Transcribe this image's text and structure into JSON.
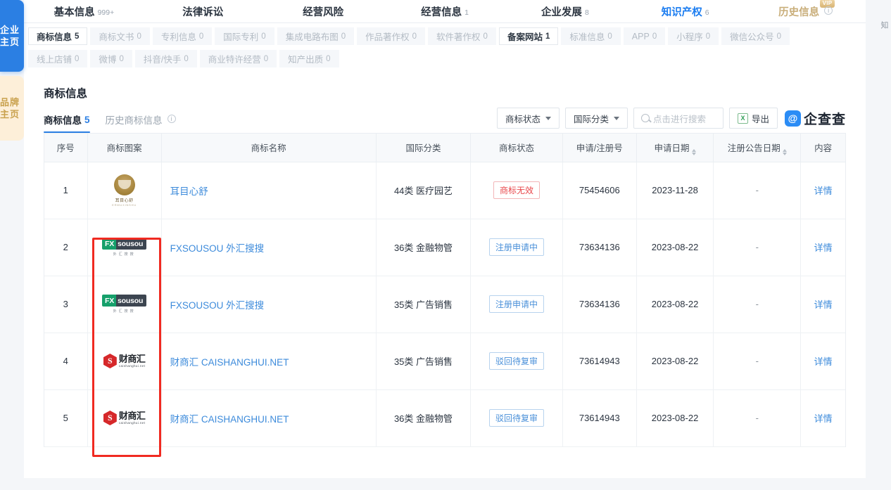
{
  "rail": {
    "tabs": [
      {
        "label": "企业主页",
        "active": true
      },
      {
        "label": "品牌主页",
        "active": false
      }
    ]
  },
  "topnav": {
    "items": [
      {
        "label": "基本信息",
        "count": "999+",
        "active": false
      },
      {
        "label": "法律诉讼",
        "count": "",
        "active": false
      },
      {
        "label": "经营风险",
        "count": "",
        "active": false
      },
      {
        "label": "经营信息",
        "count": "1",
        "active": false
      },
      {
        "label": "企业发展",
        "count": "8",
        "active": false
      },
      {
        "label": "知识产权",
        "count": "6",
        "active": true
      },
      {
        "label": "历史信息",
        "count": "",
        "active": false,
        "vip": "VIP",
        "info_icon": "info-circle-icon"
      }
    ]
  },
  "subnav": {
    "row1": [
      {
        "label": "商标信息",
        "count": "5",
        "active": true
      },
      {
        "label": "商标文书",
        "count": "0",
        "active": false
      },
      {
        "label": "专利信息",
        "count": "0",
        "active": false
      },
      {
        "label": "国际专利",
        "count": "0",
        "active": false
      },
      {
        "label": "集成电路布图",
        "count": "0",
        "active": false
      },
      {
        "label": "作品著作权",
        "count": "0",
        "active": false
      },
      {
        "label": "软件著作权",
        "count": "0",
        "active": false
      },
      {
        "label": "备案网站",
        "count": "1",
        "active": true
      },
      {
        "label": "标准信息",
        "count": "0",
        "active": false
      },
      {
        "label": "APP",
        "count": "0",
        "active": false
      },
      {
        "label": "小程序",
        "count": "0",
        "active": false
      },
      {
        "label": "微信公众号",
        "count": "0",
        "active": false
      }
    ],
    "row2": [
      {
        "label": "线上店铺",
        "count": "0",
        "active": false
      },
      {
        "label": "微博",
        "count": "0",
        "active": false
      },
      {
        "label": "抖音/快手",
        "count": "0",
        "active": false
      },
      {
        "label": "商业特许经营",
        "count": "0",
        "active": false
      },
      {
        "label": "知产出质",
        "count": "0",
        "active": false
      }
    ]
  },
  "section": {
    "title": "商标信息",
    "subtabs": [
      {
        "label": "商标信息",
        "count": "5",
        "active": true
      },
      {
        "label": "历史商标信息",
        "count": "",
        "active": false,
        "info_icon": "info-circle-icon"
      }
    ],
    "tools": {
      "filter_status": "商标状态",
      "filter_class": "国际分类",
      "search_placeholder": "点击进行搜索",
      "export": "导出",
      "brand": "企查查"
    }
  },
  "table": {
    "columns": [
      {
        "label": "序号",
        "sortable": false
      },
      {
        "label": "商标图案",
        "sortable": false
      },
      {
        "label": "商标名称",
        "sortable": false
      },
      {
        "label": "国际分类",
        "sortable": false
      },
      {
        "label": "商标状态",
        "sortable": false
      },
      {
        "label": "申请/注册号",
        "sortable": false
      },
      {
        "label": "申请日期",
        "sortable": true
      },
      {
        "label": "注册公告日期",
        "sortable": true
      },
      {
        "label": "内容",
        "sortable": false
      }
    ],
    "rows": [
      {
        "index": "1",
        "logo": "ermuxinshu-logo",
        "logo_caption": "耳目心舒",
        "name": "耳目心舒",
        "category": "44类 医疗园艺",
        "status": "商标无效",
        "status_color": "red",
        "reg_no": "75454606",
        "apply_date": "2023-11-28",
        "announce_date": "-",
        "detail": "详情"
      },
      {
        "index": "2",
        "logo": "fxsousou-logo",
        "logo_text_a": "FX",
        "logo_text_b": "sousou",
        "logo_sub": "外汇搜搜",
        "name": "FXSOUSOU 外汇搜搜",
        "category": "36类 金融物管",
        "status": "注册申请中",
        "status_color": "blue",
        "reg_no": "73634136",
        "apply_date": "2023-08-22",
        "announce_date": "-",
        "detail": "详情"
      },
      {
        "index": "3",
        "logo": "fxsousou-logo",
        "logo_text_a": "FX",
        "logo_text_b": "sousou",
        "logo_sub": "外汇搜搜",
        "name": "FXSOUSOU 外汇搜搜",
        "category": "35类 广告销售",
        "status": "注册申请中",
        "status_color": "blue",
        "reg_no": "73634136",
        "apply_date": "2023-08-22",
        "announce_date": "-",
        "detail": "详情"
      },
      {
        "index": "4",
        "logo": "caishanghui-logo",
        "logo_mark": "S",
        "logo_text_a": "财商汇",
        "logo_sub": "caishanghui.net",
        "name": "财商汇 CAISHANGHUI.NET",
        "category": "35类 广告销售",
        "status": "驳回待复审",
        "status_color": "blue",
        "reg_no": "73614943",
        "apply_date": "2023-08-22",
        "announce_date": "-",
        "detail": "详情"
      },
      {
        "index": "5",
        "logo": "caishanghui-logo",
        "logo_mark": "S",
        "logo_text_a": "财商汇",
        "logo_sub": "caishanghui.net",
        "name": "财商汇 CAISHANGHUI.NET",
        "category": "36类 金融物管",
        "status": "驳回待复审",
        "status_color": "blue",
        "reg_no": "73614943",
        "apply_date": "2023-08-22",
        "announce_date": "-",
        "detail": "详情"
      }
    ]
  },
  "annotation": {
    "highlight_color": "#f02a21",
    "target": "商标图案"
  },
  "colors": {
    "accent_blue": "#2b7fe3",
    "link_blue": "#3d8bdb",
    "status_red": "#e8464a",
    "status_blue": "#4a90d9",
    "vip_gold": "#d8b473"
  }
}
